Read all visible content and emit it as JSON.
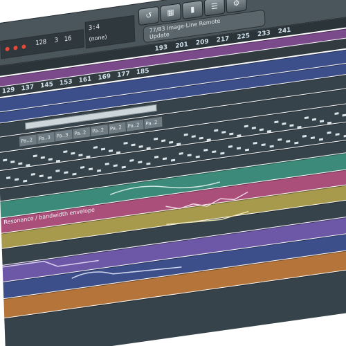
{
  "transport": {
    "tempo_display": "3:4",
    "pattern_display": "(none)",
    "digits": [
      "128",
      "3",
      "16"
    ]
  },
  "toolbar": {
    "icons": [
      "undo-icon",
      "pattern-icon",
      "piano-icon",
      "mixer-icon",
      "plugin-icon",
      "refresh-icon",
      "export-icon",
      "camera-icon",
      "cut-icon",
      "pencil-icon"
    ]
  },
  "hint_bar": {
    "line1": "77/83 Image-Line Remote",
    "line2": "Update"
  },
  "ruler_top": [
    "193",
    "201",
    "209",
    "217",
    "225",
    "233",
    "241"
  ],
  "ruler_playlist": [
    "129",
    "137",
    "145",
    "153",
    "161",
    "169",
    "177",
    "185"
  ],
  "pattern_clips": [
    "Pa..2",
    "Pa..3",
    "Pa..3",
    "Pa..2",
    "Pa..2",
    "Pa..2",
    "Pa..2",
    "Pa..2",
    "Pa..2"
  ],
  "automation_labels": {
    "resonance": "Resonance / bandwidth envelope"
  },
  "track_colors": {
    "purple": "#7a4a8a",
    "blue": "#3c4f8a",
    "teal": "#3c8a7a",
    "pink": "#a94f7a",
    "olive": "#a79a4c",
    "violet": "#6c58a6",
    "orange": "#b5753a",
    "dark": "#37434a"
  }
}
